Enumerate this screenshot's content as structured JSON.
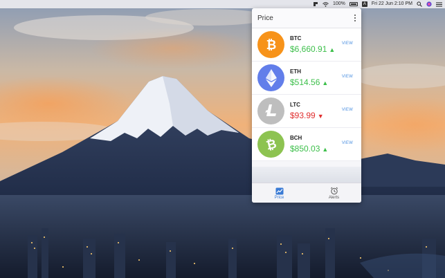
{
  "menubar": {
    "battery": "100%",
    "input_source": "A",
    "datetime": "Fri 22 Jun  2:10 PM"
  },
  "popover": {
    "title": "Price",
    "coins": [
      {
        "symbol": "BTC",
        "price": "$6,660.91",
        "trend": "up",
        "view_label": "VIEW",
        "icon": "bitcoin-icon",
        "color": "#f7931a"
      },
      {
        "symbol": "ETH",
        "price": "$514.56",
        "trend": "up",
        "view_label": "VIEW",
        "icon": "ethereum-icon",
        "color": "#627eea"
      },
      {
        "symbol": "LTC",
        "price": "$93.99",
        "trend": "down",
        "view_label": "VIEW",
        "icon": "litecoin-icon",
        "color": "#bebebe"
      },
      {
        "symbol": "BCH",
        "price": "$850.03",
        "trend": "up",
        "view_label": "VIEW",
        "icon": "bitcoin-cash-icon",
        "color": "#8dc351"
      }
    ],
    "tabs": [
      {
        "label": "Price",
        "icon": "chart-icon",
        "active": true
      },
      {
        "label": "Alerts",
        "icon": "alarm-clock-icon",
        "active": false
      }
    ],
    "colors": {
      "up": "#3cbf4a",
      "down": "#e02e2e",
      "accent": "#3a7bd5"
    }
  }
}
